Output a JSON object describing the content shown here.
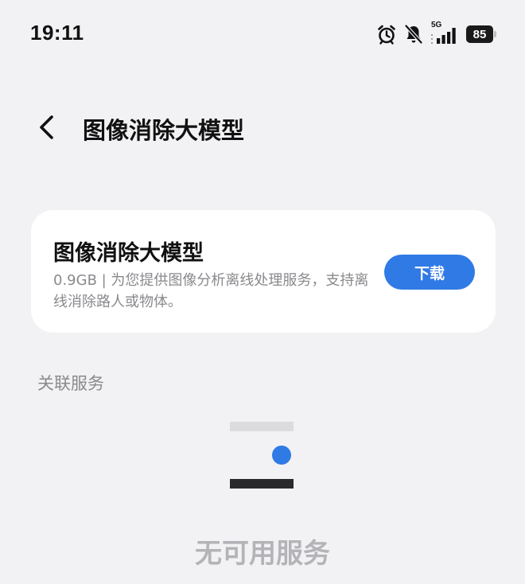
{
  "status_bar": {
    "time": "19:11",
    "network": "5G",
    "battery": "85",
    "icons": [
      "alarm-icon",
      "bell-off-icon",
      "signal-icon",
      "battery-icon"
    ]
  },
  "header": {
    "back_icon": "chevron-left-icon",
    "title": "图像消除大模型"
  },
  "model_card": {
    "name": "图像消除大模型",
    "description": "0.9GB | 为您提供图像分析离线处理服务，支持离线消除路人或物体。",
    "download_label": "下载"
  },
  "related_services": {
    "label": "关联服务",
    "empty_text": "无可用服务"
  },
  "colors": {
    "background": "#f2f2f4",
    "card": "#ffffff",
    "accent": "#2f7ae5",
    "secondary_text": "#8a8a8e",
    "empty_text": "#b4b4b8"
  }
}
